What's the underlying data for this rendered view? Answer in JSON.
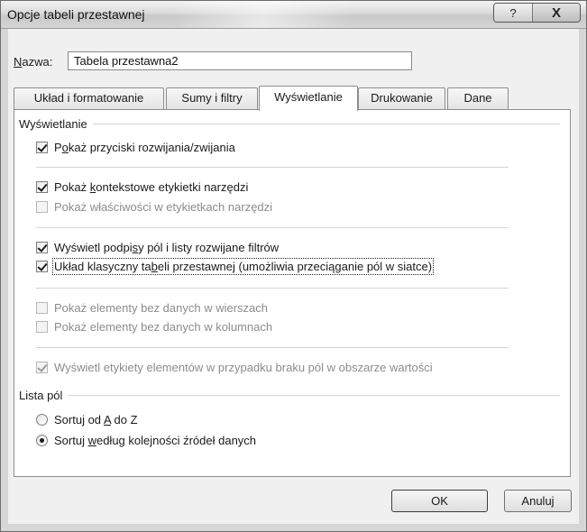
{
  "window": {
    "title": "Opcje tabeli przestawnej"
  },
  "title_buttons": {
    "help": "?",
    "close": "X"
  },
  "name_field": {
    "label_accel": "N",
    "label_rest": "azwa:",
    "value": "Tabela przestawna2"
  },
  "tabs": [
    {
      "label": "Układ i formatowanie",
      "active": false
    },
    {
      "label": "Sumy i filtry",
      "active": false
    },
    {
      "label": "Wyświetlanie",
      "active": true
    },
    {
      "label": "Drukowanie",
      "active": false
    },
    {
      "label": "Dane",
      "active": false
    }
  ],
  "display_section": {
    "heading": "Wyświetlanie",
    "options": [
      {
        "pre": "P",
        "accel": "o",
        "post": "każ przyciski rozwijania/zwijania",
        "checked": true,
        "enabled": true
      },
      {
        "pre": "Pokaż ",
        "accel": "k",
        "post": "ontekstowe etykietki narzędzi",
        "checked": true,
        "enabled": true
      },
      {
        "pre": "Pokaż właściwości w etykietkach narzędzi",
        "accel": "",
        "post": "",
        "checked": false,
        "enabled": false
      },
      {
        "pre": "Wyświetl podpi",
        "accel": "s",
        "post": "y pól i listy rozwijane filtrów",
        "checked": true,
        "enabled": true
      },
      {
        "pre": "Układ klasyczny ta",
        "accel": "b",
        "post": "eli przestawnej (umożliwia przeciąganie pól w siatce)",
        "checked": true,
        "enabled": true,
        "focused": true
      },
      {
        "pre": "Pokaż elementy bez danych w wierszach",
        "accel": "",
        "post": "",
        "checked": false,
        "enabled": false
      },
      {
        "pre": "Pokaż elementy bez danych w kolumnach",
        "accel": "",
        "post": "",
        "checked": false,
        "enabled": false
      },
      {
        "pre": "Wyświetl etykiety elementów w przypadku braku pól w obszarze wartości",
        "accel": "",
        "post": "",
        "checked": true,
        "enabled": false
      }
    ]
  },
  "field_list_section": {
    "heading": "Lista pól",
    "options": [
      {
        "pre": "Sortuj od ",
        "accel": "A",
        "post": " do Z",
        "selected": false
      },
      {
        "pre": "Sortuj ",
        "accel": "w",
        "post": "edług kolejności źródeł danych",
        "selected": true
      }
    ]
  },
  "buttons": {
    "ok": "OK",
    "cancel": "Anuluj"
  }
}
